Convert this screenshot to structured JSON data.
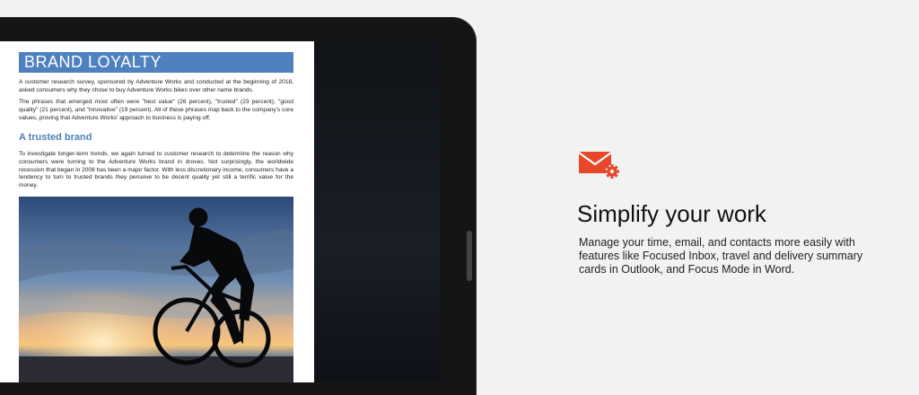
{
  "document": {
    "heading": "BRAND LOYALTY",
    "paragraph1": "A customer research survey, sponsored by Adventure Works and conducted at the beginning of 2018, asked consumers why they chose to buy Adventure Works bikes over other name brands.",
    "paragraph2": "The phrases that emerged most often were \"best value\" (26 percent), \"trusted\" (23 percent), \"good quality\" (21 percent), and \"innovative\" (19 percent). All of these phrases map back to the company's core values, proving that Adventure Works' approach to business is paying off.",
    "subheading": "A trusted brand",
    "paragraph3": "To investigate longer-term trends, we again turned to customer research to determine the reason why consumers were turning to the Adventure Works brand in droves. Not surprisingly, the worldwide recession that began in 2008 has been a major factor. With less discretionary income, consumers have a tendency to turn to trusted brands they perceive to be decent quality yet still a terrific value for the money."
  },
  "feature": {
    "icon": "mail-gear-icon",
    "title": "Simplify your work",
    "description": "Manage your time, email, and contacts more easily with features like Focused Inbox, travel and delivery summary cards in Outlook, and Focus Mode in Word."
  },
  "colors": {
    "accent": "#e8482a",
    "heading_blue": "#4f80bf",
    "background": "#f2f2f2"
  }
}
